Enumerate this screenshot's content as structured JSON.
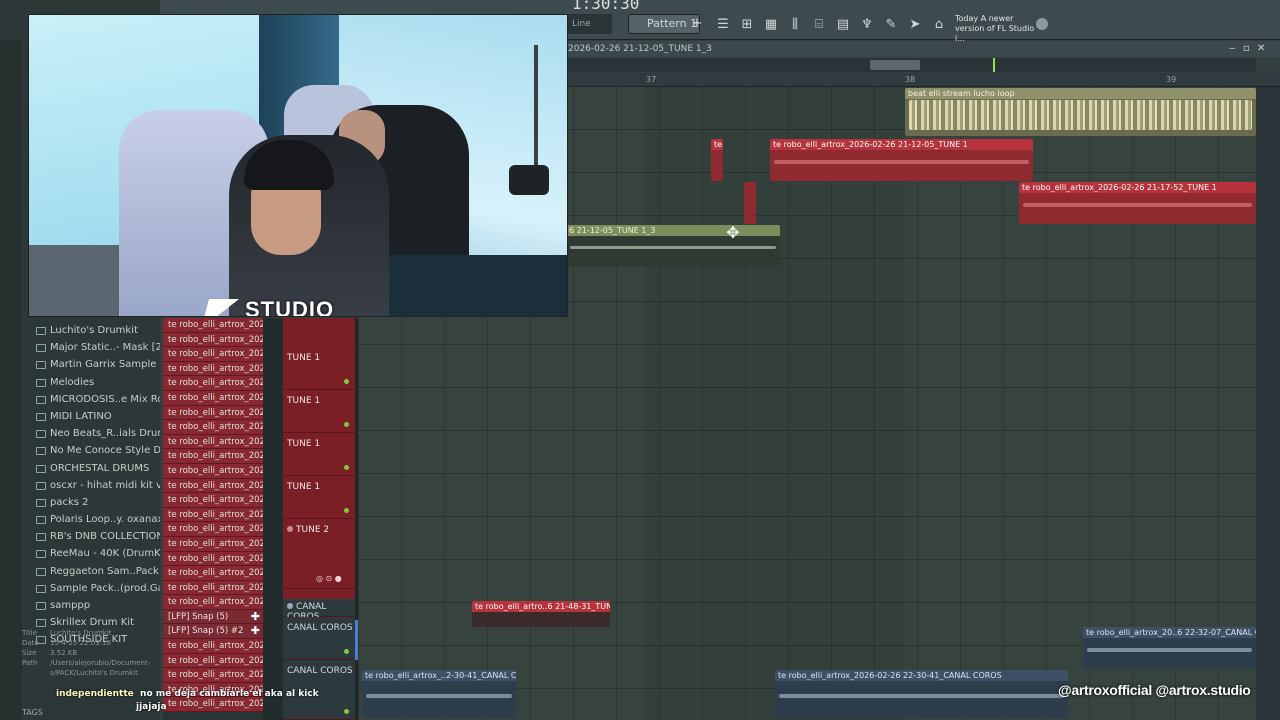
{
  "toolbar": {
    "time": "1:30:30",
    "line_mode": "Line",
    "pattern": "Pattern 1",
    "pattern_add": "+",
    "news_heading": "Today",
    "news_text": "A newer version of FL Studio i..."
  },
  "playlist": {
    "title": "2026-02-26 21-12-05_TUNE 1_3",
    "ruler": [
      "37",
      "38",
      "39"
    ],
    "clips": [
      {
        "label": "beat elli stream lucho loop",
        "color": "cream"
      },
      {
        "label": "te robo_elli_artrox_2026-02-26 21-12-05_TUNE 1",
        "color": "red"
      },
      {
        "label": "te...",
        "color": "red"
      },
      {
        "label": "te robo_elli_artrox_2026-02-26 21-17-52_TUNE 1",
        "color": "red"
      },
      {
        "label": "6 21-12-05_TUNE 1_3",
        "color": "green"
      },
      {
        "label": "te robo_elli_artro..6 21-48-31_TUNE 1",
        "color": "red"
      },
      {
        "label": "te robo_elli_artrox_20..6 22-32-07_CANAL COROS",
        "color": "blue"
      },
      {
        "label": "te robo_elli_artrox_..2-30-41_CANAL COROS",
        "color": "blue"
      },
      {
        "label": "te robo_elli_artrox_2026-02-26 22-30-41_CANAL COROS",
        "color": "blue"
      }
    ]
  },
  "browser": {
    "items": [
      "Luchito's Drumkit",
      "Major Static..- Mask [2020]",
      "Martin Garrix Sample Pack",
      "Melodies",
      "MICRODOSIS..e Mix Room)",
      "MIDI LATINO",
      "Neo Beats_R..ials Drum Kit",
      "No Me Conoce Style Drums",
      "ORCHESTAL DRUMS",
      "oscxr - hihat midi kit vol.2",
      "packs 2",
      "Polaris Loop..y. oxanax2mg",
      "RB's DNB COLLECTION",
      "ReeMau - 40K (DrumKit)",
      "Reggaeton Sam..Pack Vol. 1",
      "Sample Pack..(prod.Gaara)",
      "samppp",
      "Skrillex Drum Kit",
      "SOUTHSIDE KIT"
    ],
    "info": {
      "title_key": "Title",
      "title_val": "Luchito's Drumkit",
      "date_key": "Date",
      "date_val": "15-4-25 22:03:18",
      "size_key": "Size",
      "size_val": "3.52 KB",
      "path_key": "Path",
      "path_val": "/Users/alejorubio/Document- s/PACK/Luchito's Drumkit"
    },
    "tags_label": "TAGS"
  },
  "channels": {
    "rows": [
      "te robo_elli_artrox_202...",
      "te robo_elli_artrox_202...",
      "te robo_elli_artrox_202...",
      "te robo_elli_artrox_202...",
      "te robo_elli_artrox_202...",
      "te robo_elli_artrox_202...",
      "te robo_elli_artrox_202...",
      "te robo_elli_artrox_202...",
      "te robo_elli_artrox_202...",
      "te robo_elli_artrox_202...",
      "te robo_elli_artrox_202...",
      "te robo_elli_artrox_202...",
      "te robo_elli_artrox_202...",
      "te robo_elli_artrox_202...",
      "te robo_elli_artrox_202...",
      "te robo_elli_artrox_202...",
      "te robo_elli_artrox_202...",
      "te robo_elli_artrox_202...",
      "te robo_elli_artrox_202...",
      "te robo_elli_artrox_202..."
    ],
    "snap1": "[LFP] Snap (5)",
    "snap2": "[LFP] Snap (5) #2",
    "rows_after": [
      "te robo_elli_artrox_202...",
      "te robo_elli_artrox_202...",
      "te robo_elli_artrox_202...",
      "te robo_elli_artrox_202...",
      "te robo_elli_artrox_202..."
    ]
  },
  "tracks": {
    "t1": "TUNE 1",
    "t2": "TUNE 1",
    "t3": "TUNE 1",
    "t4": "TUNE 1",
    "t5": "TUNE 2",
    "t6": "CANAL COROS",
    "t7": "CANAL COROS",
    "t8": "CANAL COROS"
  },
  "overlay": {
    "logo": "STUDIO",
    "subtitle_highlight": "independientte",
    "subtitle_line1": "no me deja cambiarle el aka al kick",
    "subtitle_line2": "jjajaja",
    "socials": "@artroxofficial  @artrox.studio"
  }
}
